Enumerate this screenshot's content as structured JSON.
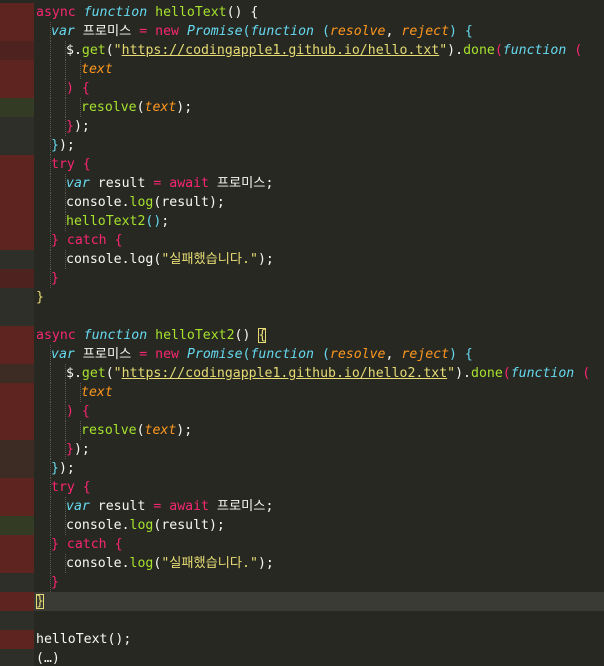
{
  "editor": {
    "theme_colors": {
      "background": "#272822",
      "current_line": "#3a3b34",
      "keyword": "#f92672",
      "storage": "#66d9ef",
      "function_name": "#a6e22e",
      "parameter": "#fd971f",
      "string": "#e6db74",
      "plain": "#f8f8f2"
    },
    "gutter_colors": [
      "#5e2420",
      "#4e231f",
      "#3c2c24",
      "#343b24",
      "#2f2f2a"
    ],
    "lines": [
      {
        "gutter": 0,
        "indent": 0,
        "tokens": [
          [
            "kw",
            "async"
          ],
          [
            "pl",
            " "
          ],
          [
            "st",
            "function"
          ],
          [
            "pl",
            " "
          ],
          [
            "fn",
            "helloText"
          ],
          [
            "pl",
            "() {"
          ]
        ]
      },
      {
        "gutter": 0,
        "indent": 1,
        "tokens": [
          [
            "st",
            "var"
          ],
          [
            "pl",
            " 프로미스 "
          ],
          [
            "kw",
            "="
          ],
          [
            "pl",
            " "
          ],
          [
            "kw",
            "new"
          ],
          [
            "pl",
            " "
          ],
          [
            "st",
            "Promise"
          ],
          [
            "br2",
            "("
          ],
          [
            "st",
            "function"
          ],
          [
            "pl",
            " "
          ],
          [
            "br2",
            "("
          ],
          [
            "pa",
            "resolve"
          ],
          [
            "pl",
            ", "
          ],
          [
            "pa",
            "reject"
          ],
          [
            "br2",
            ")"
          ],
          [
            "pl",
            " "
          ],
          [
            "br2",
            "{"
          ]
        ]
      },
      {
        "gutter": 1,
        "indent": 2,
        "tokens": [
          [
            "pl",
            "$."
          ],
          [
            "fn",
            "get"
          ],
          [
            "pl",
            "("
          ],
          [
            "sr",
            "\""
          ],
          [
            "sr-url",
            "https://codingapple1.github.io/hello.txt"
          ],
          [
            "sr",
            "\""
          ],
          [
            "pl",
            ")."
          ],
          [
            "fn",
            "done"
          ],
          [
            "br3",
            "("
          ],
          [
            "st",
            "function"
          ],
          [
            "pl",
            " "
          ],
          [
            "br3",
            "("
          ]
        ]
      },
      {
        "gutter": 0,
        "indent": 3,
        "tokens": [
          [
            "pa",
            "text"
          ]
        ]
      },
      {
        "gutter": 0,
        "indent": 2,
        "tokens": [
          [
            "br3",
            ")"
          ],
          [
            "pl",
            " "
          ],
          [
            "br3",
            "{"
          ]
        ]
      },
      {
        "gutter": 3,
        "indent": 3,
        "tokens": [
          [
            "fn",
            "resolve"
          ],
          [
            "br1",
            "("
          ],
          [
            "pa",
            "text"
          ],
          [
            "br1",
            ")"
          ],
          [
            "pl",
            ";"
          ]
        ]
      },
      {
        "gutter": 4,
        "indent": 2,
        "tokens": [
          [
            "br3",
            "}"
          ],
          [
            "pl",
            ");"
          ]
        ]
      },
      {
        "gutter": 4,
        "indent": 1,
        "tokens": [
          [
            "br2",
            "}"
          ],
          [
            "pl",
            ");"
          ]
        ]
      },
      {
        "gutter": 0,
        "indent": 1,
        "tokens": [
          [
            "kw",
            "try"
          ],
          [
            "pl",
            " "
          ],
          [
            "br3",
            "{"
          ]
        ]
      },
      {
        "gutter": 0,
        "indent": 2,
        "tokens": [
          [
            "st",
            "var"
          ],
          [
            "pl",
            " result "
          ],
          [
            "kw",
            "="
          ],
          [
            "pl",
            " "
          ],
          [
            "kw",
            "await"
          ],
          [
            "pl",
            " 프로미스;"
          ]
        ]
      },
      {
        "gutter": 0,
        "indent": 2,
        "tokens": [
          [
            "pl",
            "console."
          ],
          [
            "fn",
            "log"
          ],
          [
            "br1",
            "("
          ],
          [
            "pl",
            "result"
          ],
          [
            "br1",
            ")"
          ],
          [
            "pl",
            ";"
          ]
        ]
      },
      {
        "gutter": 0,
        "indent": 2,
        "tokens": [
          [
            "fn",
            "helloText2"
          ],
          [
            "br2",
            "()"
          ],
          [
            "pl",
            ";"
          ]
        ]
      },
      {
        "gutter": 0,
        "indent": 1,
        "tokens": [
          [
            "br3",
            "}"
          ],
          [
            "pl",
            " "
          ],
          [
            "kw",
            "catch"
          ],
          [
            "pl",
            " "
          ],
          [
            "br3",
            "{"
          ]
        ]
      },
      {
        "gutter": 4,
        "indent": 2,
        "tokens": [
          [
            "pl",
            "console."
          ],
          [
            "pl",
            "log"
          ],
          [
            "br1",
            "("
          ],
          [
            "sr",
            "\"실패했습니다.\""
          ],
          [
            "br1",
            ")"
          ],
          [
            "pl",
            ";"
          ]
        ]
      },
      {
        "gutter": 1,
        "indent": 1,
        "tokens": [
          [
            "br3",
            "}"
          ]
        ]
      },
      {
        "gutter": 4,
        "indent": 0,
        "tokens": [
          [
            "mark",
            "}"
          ]
        ]
      },
      {
        "gutter": 4,
        "indent": 0,
        "tokens": []
      },
      {
        "gutter": 0,
        "indent": 0,
        "tokens": [
          [
            "kw",
            "async"
          ],
          [
            "pl",
            " "
          ],
          [
            "st",
            "function"
          ],
          [
            "pl",
            " "
          ],
          [
            "fn",
            "helloText2"
          ],
          [
            "pl",
            "() "
          ],
          [
            "box",
            "{"
          ]
        ]
      },
      {
        "gutter": 0,
        "indent": 1,
        "tokens": [
          [
            "st",
            "var"
          ],
          [
            "pl",
            " 프로미스 "
          ],
          [
            "kw",
            "="
          ],
          [
            "pl",
            " "
          ],
          [
            "kw",
            "new"
          ],
          [
            "pl",
            " "
          ],
          [
            "st",
            "Promise"
          ],
          [
            "br2",
            "("
          ],
          [
            "st",
            "function"
          ],
          [
            "pl",
            " "
          ],
          [
            "br2",
            "("
          ],
          [
            "pa",
            "resolve"
          ],
          [
            "pl",
            ", "
          ],
          [
            "pa",
            "reject"
          ],
          [
            "br2",
            ")"
          ],
          [
            "pl",
            " "
          ],
          [
            "br2",
            "{"
          ]
        ]
      },
      {
        "gutter": 2,
        "indent": 2,
        "tokens": [
          [
            "pl",
            "$."
          ],
          [
            "fn",
            "get"
          ],
          [
            "pl",
            "("
          ],
          [
            "sr",
            "\""
          ],
          [
            "sr-url",
            "https://codingapple1.github.io/hello2.txt"
          ],
          [
            "sr",
            "\""
          ],
          [
            "pl",
            ")."
          ],
          [
            "fn",
            "done"
          ],
          [
            "br3",
            "("
          ],
          [
            "st",
            "function"
          ],
          [
            "pl",
            " "
          ],
          [
            "br3",
            "("
          ]
        ]
      },
      {
        "gutter": 0,
        "indent": 3,
        "tokens": [
          [
            "pa",
            "text"
          ]
        ]
      },
      {
        "gutter": 0,
        "indent": 2,
        "tokens": [
          [
            "br3",
            ")"
          ],
          [
            "pl",
            " "
          ],
          [
            "br3",
            "{"
          ]
        ]
      },
      {
        "gutter": 0,
        "indent": 3,
        "tokens": [
          [
            "fn",
            "resolve"
          ],
          [
            "br1",
            "("
          ],
          [
            "pa",
            "text"
          ],
          [
            "br1",
            ")"
          ],
          [
            "pl",
            ";"
          ]
        ]
      },
      {
        "gutter": 2,
        "indent": 2,
        "tokens": [
          [
            "br3",
            "}"
          ],
          [
            "pl",
            ");"
          ]
        ]
      },
      {
        "gutter": 2,
        "indent": 1,
        "tokens": [
          [
            "br2",
            "}"
          ],
          [
            "pl",
            ");"
          ]
        ]
      },
      {
        "gutter": 0,
        "indent": 1,
        "tokens": [
          [
            "kw",
            "try"
          ],
          [
            "pl",
            " "
          ],
          [
            "br3",
            "{"
          ]
        ]
      },
      {
        "gutter": 0,
        "indent": 2,
        "tokens": [
          [
            "st",
            "var"
          ],
          [
            "pl",
            " result "
          ],
          [
            "kw",
            "="
          ],
          [
            "pl",
            " "
          ],
          [
            "kw",
            "await"
          ],
          [
            "pl",
            " 프로미스;"
          ]
        ]
      },
      {
        "gutter": 3,
        "indent": 2,
        "tokens": [
          [
            "pl",
            "console."
          ],
          [
            "fn",
            "log"
          ],
          [
            "br1",
            "("
          ],
          [
            "pl",
            "result"
          ],
          [
            "br1",
            ")"
          ],
          [
            "pl",
            ";"
          ]
        ]
      },
      {
        "gutter": 0,
        "indent": 1,
        "tokens": [
          [
            "br3",
            "}"
          ],
          [
            "pl",
            " "
          ],
          [
            "kw",
            "catch"
          ],
          [
            "pl",
            " "
          ],
          [
            "br3",
            "{"
          ]
        ]
      },
      {
        "gutter": 0,
        "indent": 2,
        "tokens": [
          [
            "pl",
            "console."
          ],
          [
            "fn",
            "log"
          ],
          [
            "br1",
            "("
          ],
          [
            "sr",
            "\"실패했습니다.\""
          ],
          [
            "br1",
            ")"
          ],
          [
            "pl",
            ";"
          ]
        ]
      },
      {
        "gutter": 4,
        "indent": 1,
        "tokens": [
          [
            "br3",
            "}"
          ]
        ]
      },
      {
        "gutter": 0,
        "indent": 0,
        "current": true,
        "tokens": [
          [
            "box",
            "}"
          ]
        ]
      },
      {
        "gutter": 4,
        "indent": 0,
        "tokens": []
      },
      {
        "gutter": 0,
        "indent": 0,
        "tokens": [
          [
            "pl",
            "helloText();"
          ]
        ]
      },
      {
        "gutter": 4,
        "indent": 0,
        "tokens": [
          [
            "pl",
            "(…)"
          ]
        ]
      }
    ]
  }
}
